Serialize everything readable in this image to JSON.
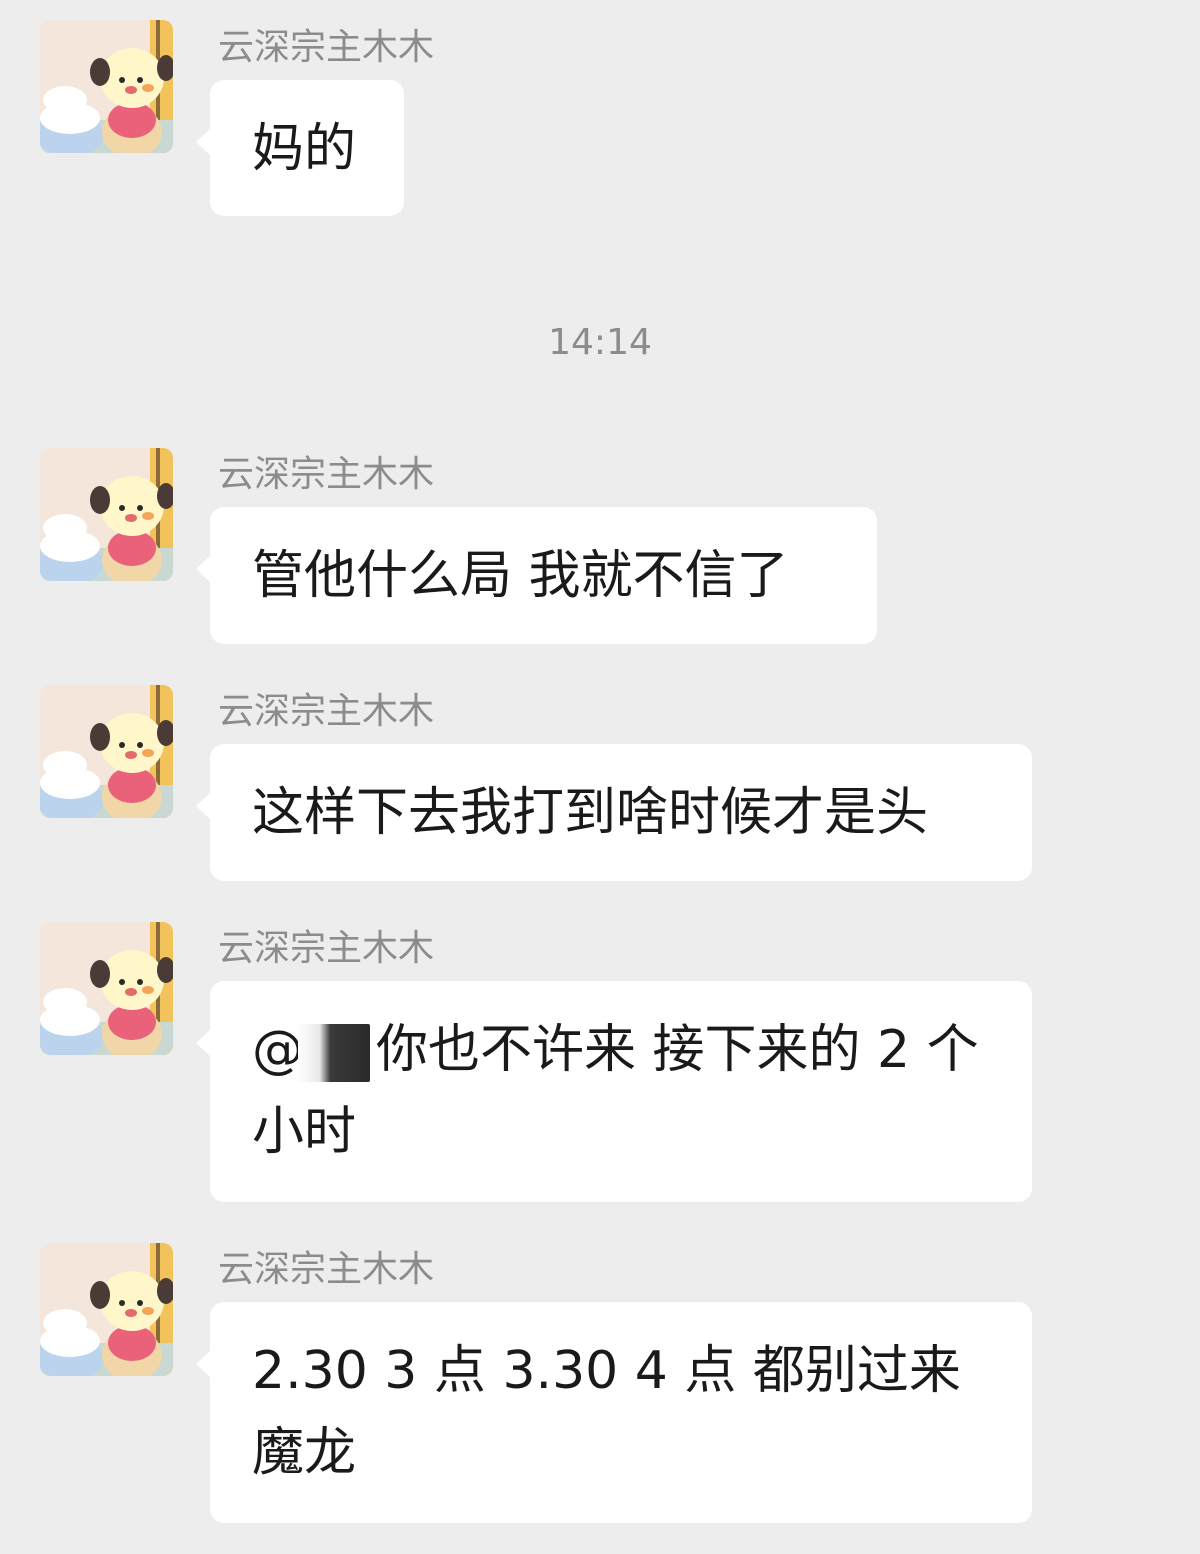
{
  "time_divider": "14:14",
  "messages": [
    {
      "sender": "云深宗主木木",
      "text": "妈的"
    },
    {
      "sender": "云深宗主木木",
      "text": "管他什么局 我就不信了"
    },
    {
      "sender": "云深宗主木木",
      "text": "这样下去我打到啥时候才是头"
    },
    {
      "sender": "云深宗主木木",
      "mention": "@",
      "text": "你也不许来 接下来的 2 个小时"
    },
    {
      "sender": "云深宗主木木",
      "text": "2.30 3 点 3.30  4 点 都别过来 魔龙"
    }
  ]
}
